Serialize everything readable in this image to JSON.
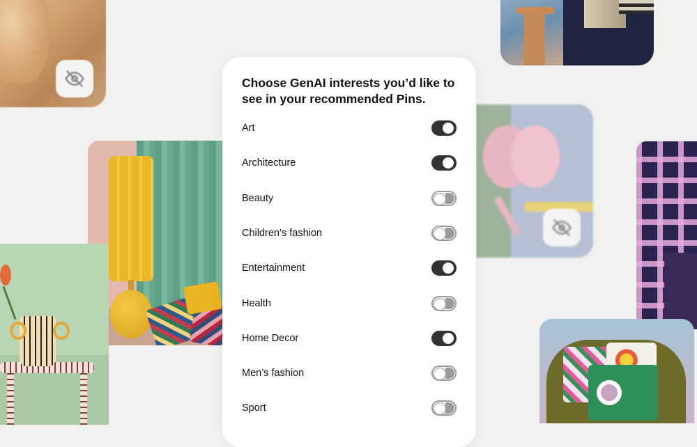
{
  "heading": "Choose GenAI interests you’d like to see in your recommended Pins.",
  "interests": [
    {
      "label": "Art",
      "enabled": true
    },
    {
      "label": "Architecture",
      "enabled": true
    },
    {
      "label": "Beauty",
      "enabled": false
    },
    {
      "label": "Children’s fashion",
      "enabled": false
    },
    {
      "label": "Entertainment",
      "enabled": true
    },
    {
      "label": "Health",
      "enabled": false
    },
    {
      "label": "Home Decor",
      "enabled": true
    },
    {
      "label": "Men’s fashion",
      "enabled": false
    },
    {
      "label": "Sport",
      "enabled": false
    }
  ],
  "colors": {
    "background": "#f1f1ef",
    "toggle_on": "#333333",
    "toggle_off": "#9a9a9a",
    "card": "#ffffff"
  },
  "icons": {
    "hidden_pin_badge": "eye-off-icon"
  }
}
